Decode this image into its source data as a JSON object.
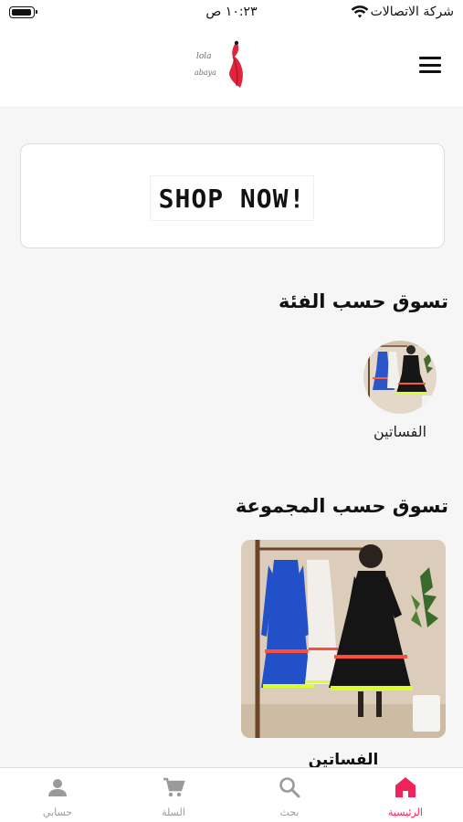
{
  "status_bar": {
    "carrier": "شركة الاتصالات",
    "time": "١٠:٢٣ ص"
  },
  "header": {
    "logo_text": "lola abaya",
    "menu_icon": "hamburger-menu-icon"
  },
  "banner": {
    "button_label": "SHOP NOW!"
  },
  "categories_section": {
    "title": "تسوق حسب الفئة",
    "items": [
      {
        "label": "الفساتين"
      }
    ]
  },
  "collections_section": {
    "title": "تسوق حسب المجموعة",
    "items": [
      {
        "label": "الفساتين"
      }
    ]
  },
  "tab_bar": {
    "tabs": [
      {
        "label": "الرئيسية",
        "icon": "home-icon",
        "active": true
      },
      {
        "label": "بحث",
        "icon": "search-icon",
        "active": false
      },
      {
        "label": "السلة",
        "icon": "cart-icon",
        "active": false
      },
      {
        "label": "حسابي",
        "icon": "person-icon",
        "active": false
      }
    ]
  },
  "colors": {
    "accent": "#f0245a",
    "inactive_tab": "#9a9a9a",
    "background": "#f6f6f6"
  }
}
